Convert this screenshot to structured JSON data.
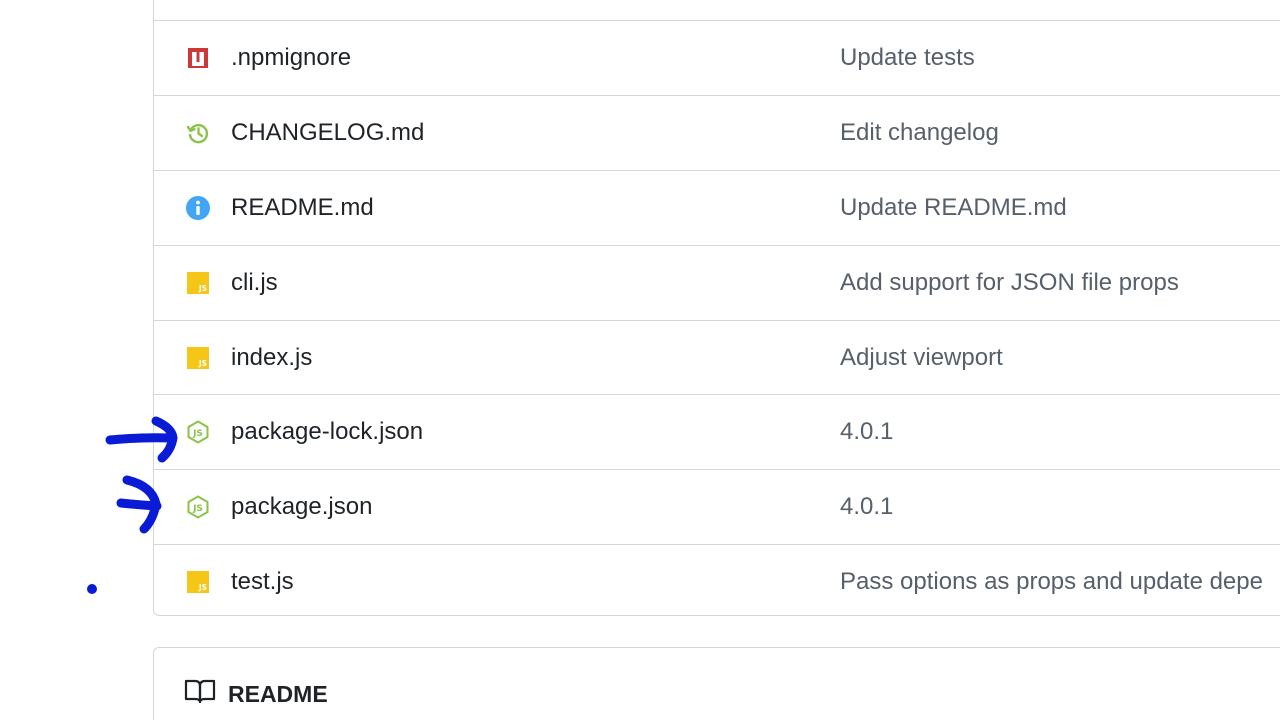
{
  "files": [
    {
      "name": ".npmignore",
      "message": "Update tests",
      "icon": "npm-icon"
    },
    {
      "name": "CHANGELOG.md",
      "message": "Edit changelog",
      "icon": "history-icon"
    },
    {
      "name": "README.md",
      "message": "Update README.md",
      "icon": "info-icon"
    },
    {
      "name": "cli.js",
      "message": "Add support for JSON file props",
      "icon": "javascript-file-icon"
    },
    {
      "name": "index.js",
      "message": "Adjust viewport",
      "icon": "javascript-file-icon"
    },
    {
      "name": "package-lock.json",
      "message": "4.0.1",
      "icon": "nodejs-icon"
    },
    {
      "name": "package.json",
      "message": "4.0.1",
      "icon": "nodejs-icon"
    },
    {
      "name": "test.js",
      "message": "Pass options as props and update depe",
      "icon": "javascript-file-icon"
    }
  ],
  "readme": {
    "title": "README",
    "icon": "book-icon"
  },
  "colors": {
    "npm": "#cb3837",
    "history": "#8bc34a",
    "info": "#42a5f5",
    "javascript": "#f5c518",
    "nodejs": "#8bc34a",
    "annotation": "#0a1bd6",
    "border": "#d0d7de",
    "message": "#57606a"
  }
}
